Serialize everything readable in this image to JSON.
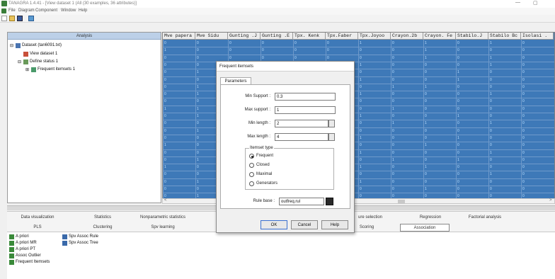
{
  "window": {
    "title": "TANAGRA 1.4.41 - [View dataset 1 (All (30 examples, 36 attributes)]",
    "minimize": "—",
    "restore": "▢"
  },
  "menu": [
    "File",
    "Diagram",
    "Component",
    "Window",
    "Help"
  ],
  "analysis": {
    "header": "Analysis",
    "tree": [
      {
        "label": "Dataset (tan6091.txt)"
      },
      {
        "label": "View dataset 1"
      },
      {
        "label": "Define status 1"
      },
      {
        "label": "Frequent itemsets 1"
      }
    ]
  },
  "grid": {
    "columns": [
      "Mve papera",
      "Mve Sidu",
      "Gunting .J",
      "Gunting .E",
      "Tpx. Kenk",
      "Tpx.Faber",
      "Tpx.Joyoo",
      "Crayon.2b",
      "Crayon. Fe",
      "Stabilo.J",
      "Stabilo Bc",
      "Isolasi ."
    ],
    "rows": [
      [
        "0",
        "0",
        "0",
        "0",
        "0",
        "0",
        "1",
        "0",
        "1",
        "0",
        "1",
        "0"
      ],
      [
        "1",
        "0",
        "0",
        "0",
        "0",
        "0",
        "0",
        "0",
        "1",
        "0",
        "0",
        "0"
      ],
      [
        "0",
        "0",
        "0",
        "0",
        "0",
        "0",
        "0",
        "0",
        "1",
        "0",
        "1",
        "0"
      ],
      [
        "0",
        "0",
        "0",
        "0",
        "0",
        "0",
        "1",
        "0",
        "0",
        "0",
        "1",
        "0"
      ],
      [
        "0",
        "1",
        "0",
        "0",
        "0",
        "0",
        "0",
        "0",
        "0",
        "1",
        "0",
        "0"
      ],
      [
        "0",
        "0",
        "0",
        "0",
        "0",
        "0",
        "1",
        "0",
        "0",
        "1",
        "0",
        "0"
      ],
      [
        "0",
        "1",
        "0",
        "0",
        "0",
        "0",
        "0",
        "1",
        "1",
        "0",
        "0",
        "0"
      ],
      [
        "0",
        "1",
        "0",
        "0",
        "0",
        "0",
        "1",
        "0",
        "0",
        "0",
        "1",
        "0"
      ],
      [
        "0",
        "0",
        "0",
        "0",
        "0",
        "0",
        "0",
        "0",
        "0",
        "0",
        "0",
        "0"
      ],
      [
        "1",
        "1",
        "0",
        "0",
        "0",
        "0",
        "0",
        "1",
        "0",
        "0",
        "0",
        "0"
      ],
      [
        "0",
        "1",
        "0",
        "0",
        "0",
        "0",
        "1",
        "0",
        "0",
        "1",
        "0",
        "0"
      ],
      [
        "0",
        "0",
        "0",
        "0",
        "0",
        "0",
        "0",
        "1",
        "1",
        "0",
        "1",
        "0"
      ],
      [
        "0",
        "1",
        "0",
        "0",
        "0",
        "0",
        "0",
        "0",
        "0",
        "0",
        "0",
        "0"
      ],
      [
        "0",
        "0",
        "0",
        "0",
        "0",
        "0",
        "1",
        "0",
        "0",
        "1",
        "0",
        "0"
      ],
      [
        "1",
        "0",
        "0",
        "0",
        "0",
        "0",
        "0",
        "0",
        "1",
        "0",
        "0",
        "0"
      ],
      [
        "0",
        "0",
        "0",
        "0",
        "0",
        "0",
        "1",
        "0",
        "0",
        "0",
        "1",
        "0"
      ],
      [
        "0",
        "1",
        "0",
        "0",
        "0",
        "0",
        "0",
        "1",
        "0",
        "1",
        "0",
        "0"
      ],
      [
        "1",
        "0",
        "0",
        "0",
        "0",
        "0",
        "1",
        "0",
        "1",
        "0",
        "0",
        "0"
      ],
      [
        "0",
        "0",
        "0",
        "0",
        "0",
        "0",
        "0",
        "0",
        "0",
        "0",
        "1",
        "0"
      ],
      [
        "0",
        "1",
        "0",
        "0",
        "0",
        "0",
        "1",
        "0",
        "0",
        "0",
        "0",
        "0"
      ],
      [
        "0",
        "0",
        "0",
        "0",
        "0",
        "0",
        "0",
        "0",
        "1",
        "0",
        "0",
        "0"
      ],
      [
        "0",
        "1",
        "0",
        "0",
        "0",
        "0",
        "0",
        "0",
        "0",
        "0",
        "0",
        "0"
      ]
    ],
    "scroll_left": "<",
    "scroll_right": ">"
  },
  "tabs_row1": [
    "Data visualization",
    "Statistics",
    "Nonparametric statistics",
    "",
    "",
    "ure selection",
    "Regression",
    "Factorial analysis"
  ],
  "tabs_row2": [
    "PLS",
    "Clustering",
    "Spv learning",
    "",
    "",
    "Scoring",
    "Association"
  ],
  "components": {
    "col1": [
      "A priori",
      "A priori MR",
      "A priori PT",
      "Assoc Outlier",
      "Frequent Itemsets"
    ],
    "col2": [
      "Spv Assoc Rule",
      "Spv Assoc Tree"
    ]
  },
  "dialog": {
    "title": "Frequent itemsets",
    "tab": "Parameters",
    "min_support_label": "Min Support :",
    "min_support": "0.3",
    "max_support_label": "Max support :",
    "max_support": "1",
    "min_length_label": "Min length :",
    "min_length": "2",
    "max_length_label": "Max length :",
    "max_length": "4",
    "itemset_type_label": "Itemset type",
    "types": [
      "Frequent",
      "Closed",
      "Maximal",
      "Generators"
    ],
    "selected_type": "Frequent",
    "rule_base_label": "Rule base :",
    "rule_base": "outfreq.rul",
    "ok": "OK",
    "cancel": "Cancel",
    "help": "Help"
  }
}
